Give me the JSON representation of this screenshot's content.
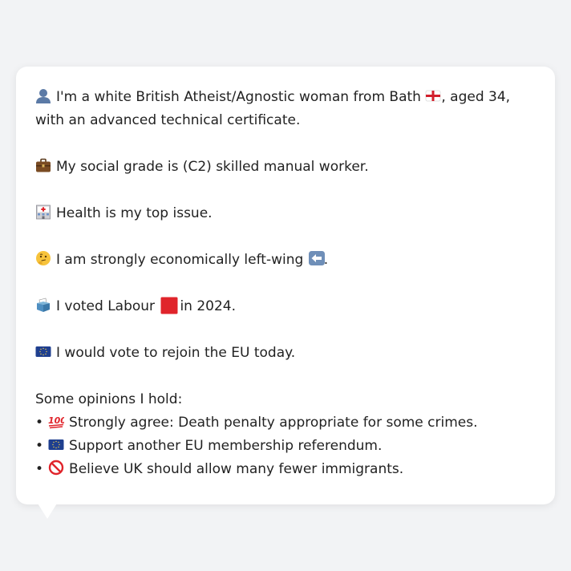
{
  "profile": {
    "intro_text_a": "I'm a white British Atheist/Agnostic woman from Bath",
    "intro_text_b": ", aged 34, with an advanced technical certificate.",
    "grade_text": "My social grade is (C2) skilled manual worker.",
    "issue_text": "Health is my top issue.",
    "economic_text": "I am strongly economically left-wing",
    "economic_end": ".",
    "vote_text_a": "I voted Labour",
    "vote_text_b": "in 2024.",
    "eu_text": "I would vote to rejoin the EU today."
  },
  "opinions": {
    "heading": "Some opinions I hold:",
    "bullet": "•",
    "items": [
      {
        "text": "Strongly agree: Death penalty appropriate for some crimes.",
        "icon": "hundred-points-icon"
      },
      {
        "text": "Support another EU membership referendum.",
        "icon": "eu-flag-icon"
      },
      {
        "text": "Believe UK should allow many fewer immigrants.",
        "icon": "prohibited-icon"
      }
    ]
  },
  "icons": {
    "person": "bust-silhouette-icon",
    "flag": "england-flag-icon",
    "briefcase": "briefcase-icon",
    "hospital": "hospital-icon",
    "thinking": "thinking-face-icon",
    "left_arrow": "left-arrow-icon",
    "ballot": "ballot-box-icon",
    "labour_square": "red-square-icon",
    "eu": "eu-flag-icon"
  },
  "colors": {
    "background": "#f2f3f5",
    "card": "#ffffff",
    "text": "#222222",
    "labour_red": "#e0242b",
    "eu_blue": "#1f3f8f"
  }
}
